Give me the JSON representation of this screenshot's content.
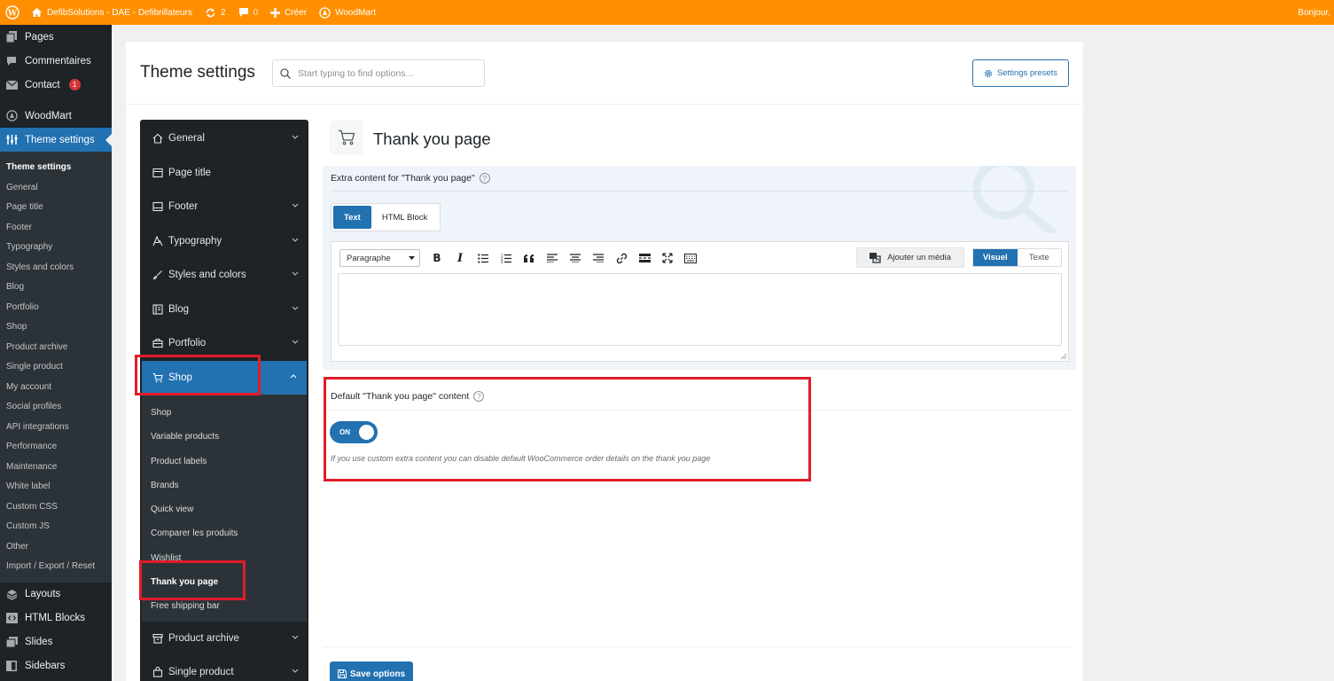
{
  "admin_bar": {
    "site_name": "DefibSolutions - DAE - Defibrillateurs",
    "updates_count": "2",
    "comments_count": "0",
    "new_label": "Créer",
    "woodmart_label": "WoodMart",
    "greeting": "Bonjour,"
  },
  "admin_menu": {
    "pages": "Pages",
    "comments": "Commentaires",
    "contact": "Contact",
    "contact_badge": "1",
    "woodmart": "WoodMart",
    "theme_settings": "Theme settings",
    "submenu": [
      "Theme settings",
      "General",
      "Page title",
      "Footer",
      "Typography",
      "Styles and colors",
      "Blog",
      "Portfolio",
      "Shop",
      "Product archive",
      "Single product",
      "My account",
      "Social profiles",
      "API integrations",
      "Performance",
      "Maintenance",
      "White label",
      "Custom CSS",
      "Custom JS",
      "Other",
      "Import / Export / Reset"
    ],
    "layouts": "Layouts",
    "html_blocks": "HTML Blocks",
    "slides": "Slides",
    "sidebars": "Sidebars"
  },
  "header": {
    "title": "Theme settings",
    "search_placeholder": "Start typing to find options...",
    "presets_label": "Settings presets"
  },
  "nav": {
    "items_top": [
      "General",
      "Page title",
      "Footer",
      "Typography",
      "Styles and colors",
      "Blog",
      "Portfolio"
    ],
    "shop": "Shop",
    "shop_sub": [
      "Shop",
      "Variable products",
      "Product labels",
      "Brands",
      "Quick view",
      "Comparer les produits",
      "Wishlist",
      "Thank you page",
      "Free shipping bar"
    ],
    "items_bottom": [
      "Product archive",
      "Single product"
    ]
  },
  "section": {
    "title": "Thank you page",
    "extra_label": "Extra content for \"Thank you page\"",
    "tabs": [
      "Text",
      "HTML Block"
    ],
    "format_select": "Paragraphe",
    "add_media": "Ajouter un média",
    "visual_tab": "Visuel",
    "text_tab": "Texte",
    "default_label": "Default \"Thank you page\" content",
    "toggle_state": "ON",
    "default_desc": "If you use custom extra content you can disable default WooCommerce order details on the thank you page",
    "save_label": "Save options"
  }
}
